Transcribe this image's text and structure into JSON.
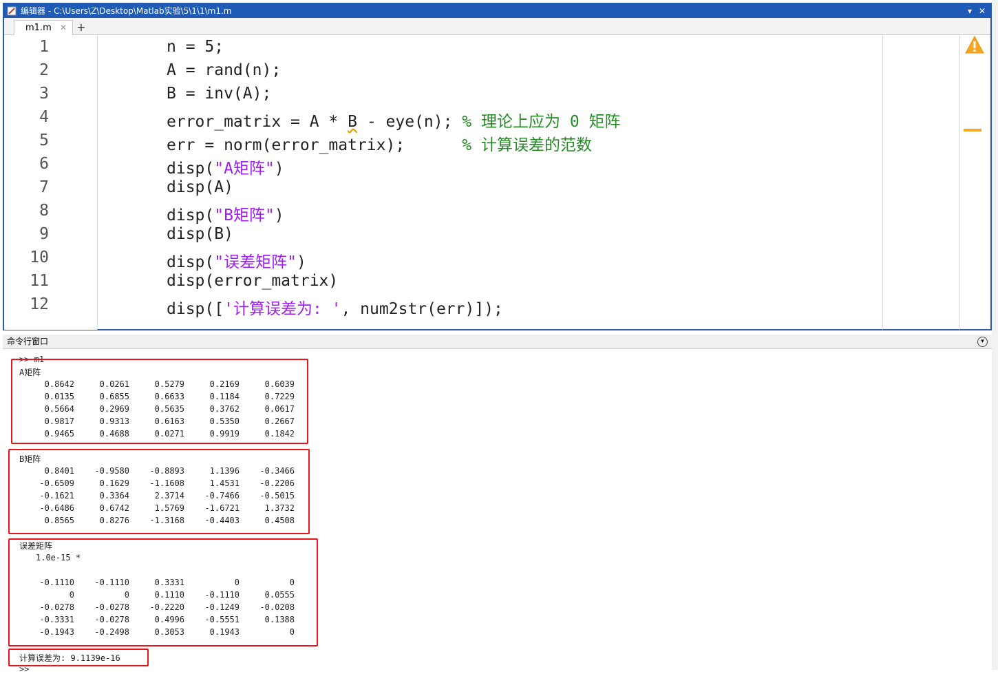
{
  "editor": {
    "title": "编辑器 - C:\\Users\\Z\\Desktop\\Matlab实验\\5\\1\\1\\m1.m",
    "tab_label": "m1.m",
    "tab_close": "✕",
    "add_tab": "+",
    "line_numbers": [
      "1",
      "2",
      "3",
      "4",
      "5",
      "6",
      "7",
      "8",
      "9",
      "10",
      "11",
      "12"
    ],
    "lines": {
      "l1": "n = 5;",
      "l2": "A = rand(n);",
      "l3": "B = inv(A);",
      "l4a": "error_matrix = A * ",
      "l4b": "B",
      "l4c": " - eye(n); ",
      "l4d": "% 理论上应为 0 矩阵",
      "l5a": "err = norm(error_matrix);      ",
      "l5b": "% 计算误差的范数",
      "l6a": "disp(",
      "l6b": "\"A矩阵\"",
      "l6c": ")",
      "l7": "disp(A)",
      "l8a": "disp(",
      "l8b": "\"B矩阵\"",
      "l8c": ")",
      "l9": "disp(B)",
      "l10a": "disp(",
      "l10b": "\"误差矩阵\"",
      "l10c": ")",
      "l11": "disp(error_matrix)",
      "l12a": "disp([",
      "l12b": "'计算误差为: '",
      "l12c": ", num2str(err)]);"
    }
  },
  "command_window": {
    "title": "命令行窗口",
    "prompt_cmd": ">> m1",
    "a_label": "A矩阵",
    "a_rows": [
      [
        "0.8642",
        "0.0261",
        "0.5279",
        "0.2169",
        "0.6039"
      ],
      [
        "0.0135",
        "0.6855",
        "0.6633",
        "0.1184",
        "0.7229"
      ],
      [
        "0.5664",
        "0.2969",
        "0.5635",
        "0.3762",
        "0.0617"
      ],
      [
        "0.9817",
        "0.9313",
        "0.6163",
        "0.5350",
        "0.2667"
      ],
      [
        "0.9465",
        "0.4688",
        "0.0271",
        "0.9919",
        "0.1842"
      ]
    ],
    "b_label": "B矩阵",
    "b_rows": [
      [
        "0.8401",
        "-0.9580",
        "-0.8893",
        "1.1396",
        "-0.3466"
      ],
      [
        "-0.6509",
        "0.1629",
        "-1.1608",
        "1.4531",
        "-0.2206"
      ],
      [
        "-0.1621",
        "0.3364",
        "2.3714",
        "-0.7466",
        "-0.5015"
      ],
      [
        "-0.6486",
        "0.6742",
        "1.5769",
        "-1.6721",
        "1.3732"
      ],
      [
        "0.8565",
        "0.8276",
        "-1.3168",
        "-0.4403",
        "0.4508"
      ]
    ],
    "e_label": "误差矩阵",
    "e_scale": "1.0e-15 *",
    "e_rows": [
      [
        "-0.1110",
        "-0.1110",
        "0.3331",
        "0",
        "0"
      ],
      [
        "0",
        "0",
        "0.1110",
        "-0.1110",
        "0.0555"
      ],
      [
        "-0.0278",
        "-0.0278",
        "-0.2220",
        "-0.1249",
        "-0.0208"
      ],
      [
        "-0.3331",
        "-0.0278",
        "0.4996",
        "-0.5551",
        "0.1388"
      ],
      [
        "-0.1943",
        "-0.2498",
        "0.3053",
        "0.1943",
        "0"
      ]
    ],
    "err_line": "计算误差为: 9.1139e-16",
    "final_prompt": ">>"
  }
}
